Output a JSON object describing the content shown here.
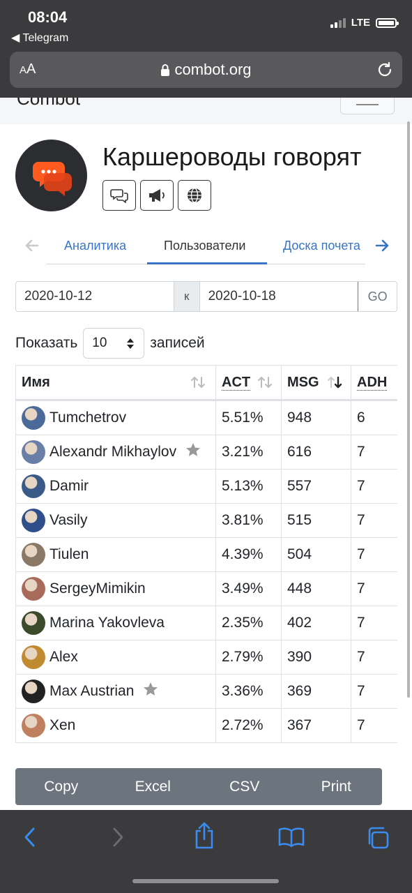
{
  "status_bar": {
    "time": "08:04",
    "back_app": "◀ Telegram",
    "network": "LTE"
  },
  "browser": {
    "aa_label_small": "A",
    "aa_label_big": "A",
    "url": "combot.org"
  },
  "site": {
    "brand": "Combot"
  },
  "group": {
    "title": "Каршероводы говорят"
  },
  "tabs": [
    {
      "label": "Аналитика",
      "active": false
    },
    {
      "label": "Пользователи",
      "active": true
    },
    {
      "label": "Доска почета",
      "active": false
    }
  ],
  "date_range": {
    "from": "2020-10-12",
    "separator": "к",
    "to": "2020-10-18",
    "go_label": "GO"
  },
  "entries": {
    "prefix": "Показать",
    "value": "10",
    "suffix": "записей"
  },
  "table": {
    "columns": [
      "Имя",
      "ACT",
      "MSG",
      "ADH"
    ],
    "rows": [
      {
        "name": "Tumchetrov",
        "act": "5.51%",
        "msg": "948",
        "ad": "6",
        "star": false,
        "color": "#4a6a9a"
      },
      {
        "name": "Alexandr Mikhaylov",
        "act": "3.21%",
        "msg": "616",
        "ad": "7",
        "star": true,
        "color": "#6a7fa8"
      },
      {
        "name": "Damir",
        "act": "5.13%",
        "msg": "557",
        "ad": "7",
        "star": false,
        "color": "#3a5a88"
      },
      {
        "name": "Vasily",
        "act": "3.81%",
        "msg": "515",
        "ad": "7",
        "star": false,
        "color": "#2f4f8a"
      },
      {
        "name": "Tiulen",
        "act": "4.39%",
        "msg": "504",
        "ad": "7",
        "star": false,
        "color": "#8a7866"
      },
      {
        "name": "SergeyMimikin",
        "act": "3.49%",
        "msg": "448",
        "ad": "7",
        "star": false,
        "color": "#a86a5a"
      },
      {
        "name": "Marina Yakovleva",
        "act": "2.35%",
        "msg": "402",
        "ad": "7",
        "star": false,
        "color": "#3a4a2a"
      },
      {
        "name": "Alex",
        "act": "2.79%",
        "msg": "390",
        "ad": "7",
        "star": false,
        "color": "#c08a30"
      },
      {
        "name": "Max Austrian",
        "act": "3.36%",
        "msg": "369",
        "ad": "7",
        "star": true,
        "color": "#222222"
      },
      {
        "name": "Xen",
        "act": "2.72%",
        "msg": "367",
        "ad": "7",
        "star": false,
        "color": "#c08060"
      }
    ]
  },
  "export_buttons": [
    "Copy",
    "Excel",
    "CSV",
    "Print"
  ],
  "colors": {
    "accent": "#3a74c6",
    "chrome": "#3b3b3d",
    "export_bg": "#6c757d"
  }
}
